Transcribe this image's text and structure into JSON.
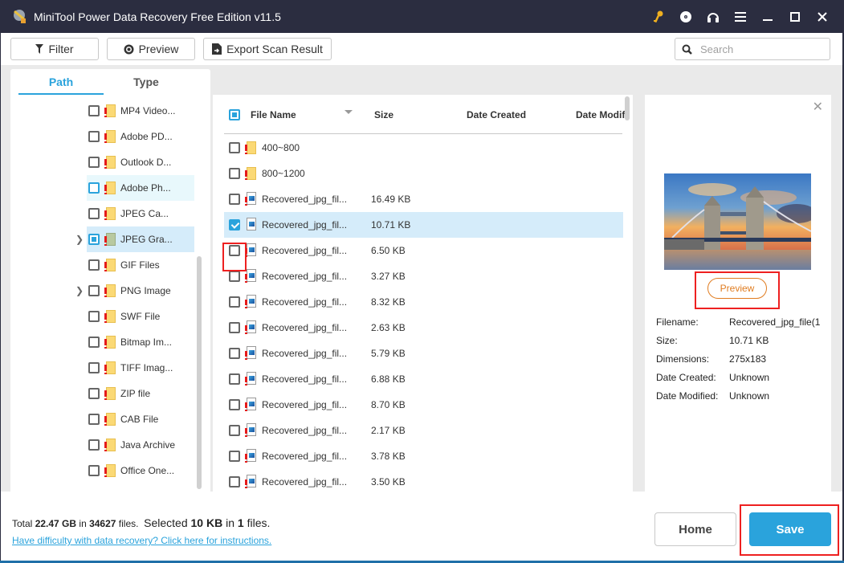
{
  "app": {
    "title": "MiniTool Power Data Recovery Free Edition v11.5",
    "title_icons": [
      "key-icon",
      "disc-icon",
      "headphones-icon",
      "menu-icon",
      "minimize-icon",
      "maximize-icon",
      "close-icon"
    ]
  },
  "toolbar": {
    "filter_label": "Filter",
    "preview_label": "Preview",
    "export_label": "Export Scan Result",
    "search_placeholder": "Search",
    "search_value": ""
  },
  "left_panel": {
    "tabs": [
      {
        "label": "Path",
        "active": true
      },
      {
        "label": "Type",
        "active": false
      }
    ],
    "tree_items": [
      {
        "label": "MP4 Video...",
        "state": "unchecked",
        "expandable": false,
        "highlight": "none"
      },
      {
        "label": "Adobe PD...",
        "state": "unchecked",
        "expandable": false,
        "highlight": "none"
      },
      {
        "label": "Outlook D...",
        "state": "unchecked",
        "expandable": false,
        "highlight": "none"
      },
      {
        "label": "Adobe Ph...",
        "state": "unchecked",
        "expandable": false,
        "highlight": "hover"
      },
      {
        "label": "JPEG Ca...",
        "state": "unchecked",
        "expandable": false,
        "highlight": "none"
      },
      {
        "label": "JPEG Gra...",
        "state": "partial",
        "expandable": true,
        "highlight": "selected"
      },
      {
        "label": "GIF Files",
        "state": "unchecked",
        "expandable": false,
        "highlight": "none"
      },
      {
        "label": "PNG Image",
        "state": "unchecked",
        "expandable": true,
        "highlight": "none"
      },
      {
        "label": "SWF File",
        "state": "unchecked",
        "expandable": false,
        "highlight": "none"
      },
      {
        "label": "Bitmap Im...",
        "state": "unchecked",
        "expandable": false,
        "highlight": "none"
      },
      {
        "label": "TIFF Imag...",
        "state": "unchecked",
        "expandable": false,
        "highlight": "none"
      },
      {
        "label": "ZIP file",
        "state": "unchecked",
        "expandable": false,
        "highlight": "none"
      },
      {
        "label": "CAB File",
        "state": "unchecked",
        "expandable": false,
        "highlight": "none"
      },
      {
        "label": "Java Archive",
        "state": "unchecked",
        "expandable": false,
        "highlight": "none"
      },
      {
        "label": "Office One...",
        "state": "unchecked",
        "expandable": false,
        "highlight": "none"
      }
    ]
  },
  "file_list": {
    "columns": [
      "File Name",
      "Size",
      "Date Created",
      "Date Modif"
    ],
    "header_checkbox_state": "partial",
    "rows": [
      {
        "name": "400~800",
        "size": "",
        "type": "folder",
        "checked": false
      },
      {
        "name": "800~1200",
        "size": "",
        "type": "folder",
        "checked": false
      },
      {
        "name": "Recovered_jpg_fil...",
        "size": "16.49 KB",
        "type": "file",
        "checked": false
      },
      {
        "name": "Recovered_jpg_fil...",
        "size": "10.71 KB",
        "type": "file",
        "checked": true
      },
      {
        "name": "Recovered_jpg_fil...",
        "size": "6.50 KB",
        "type": "file",
        "checked": false
      },
      {
        "name": "Recovered_jpg_fil...",
        "size": "3.27 KB",
        "type": "file",
        "checked": false
      },
      {
        "name": "Recovered_jpg_fil...",
        "size": "8.32 KB",
        "type": "file",
        "checked": false
      },
      {
        "name": "Recovered_jpg_fil...",
        "size": "2.63 KB",
        "type": "file",
        "checked": false
      },
      {
        "name": "Recovered_jpg_fil...",
        "size": "5.79 KB",
        "type": "file",
        "checked": false
      },
      {
        "name": "Recovered_jpg_fil...",
        "size": "6.88 KB",
        "type": "file",
        "checked": false
      },
      {
        "name": "Recovered_jpg_fil...",
        "size": "8.70 KB",
        "type": "file",
        "checked": false
      },
      {
        "name": "Recovered_jpg_fil...",
        "size": "2.17 KB",
        "type": "file",
        "checked": false
      },
      {
        "name": "Recovered_jpg_fil...",
        "size": "3.78 KB",
        "type": "file",
        "checked": false
      },
      {
        "name": "Recovered_jpg_fil...",
        "size": "3.50 KB",
        "type": "file",
        "checked": false
      }
    ]
  },
  "details": {
    "preview_button": "Preview",
    "image_subject": "Tower Bridge at sunset",
    "fields": [
      {
        "key": "Filename:",
        "value": "Recovered_jpg_file(1"
      },
      {
        "key": "Size:",
        "value": "10.71 KB"
      },
      {
        "key": "Dimensions:",
        "value": "275x183"
      },
      {
        "key": "Date Created:",
        "value": "Unknown"
      },
      {
        "key": "Date Modified:",
        "value": "Unknown"
      }
    ]
  },
  "footer": {
    "total_prefix": "Total ",
    "total_size": "22.47 GB",
    "total_in": " in ",
    "total_files": "34627",
    "total_suffix": " files.",
    "selected_prefix": "Selected ",
    "selected_size": "10 KB",
    "selected_in": " in ",
    "selected_files": "1",
    "selected_suffix": " files.",
    "help_link": "Have difficulty with data recovery? Click here for instructions.",
    "home_label": "Home",
    "save_label": "Save"
  },
  "colors": {
    "accent": "#2aa3dc",
    "titlebar": "#2b2d40",
    "preview_orange": "#e07c20",
    "highlight_red": "#ee2020"
  }
}
